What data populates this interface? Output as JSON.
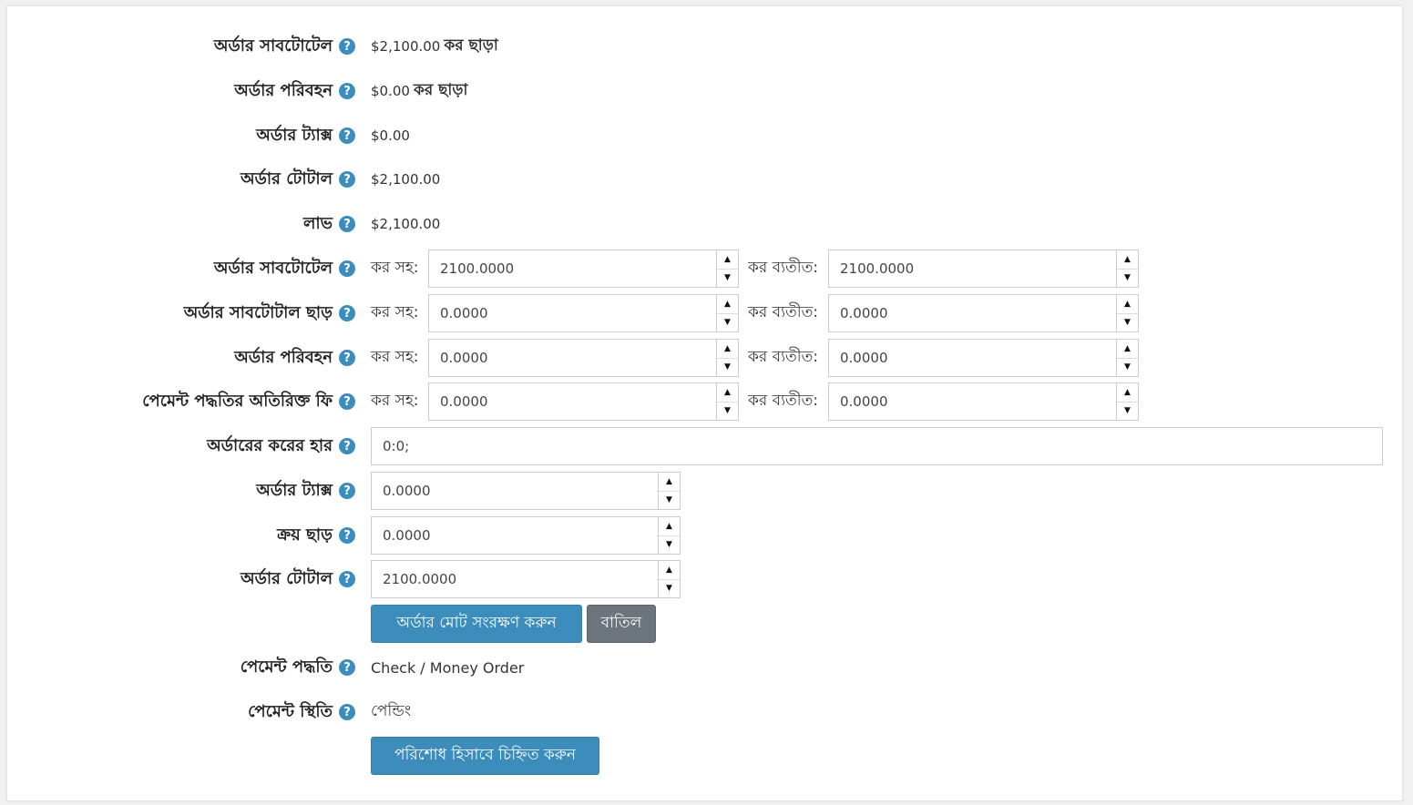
{
  "summary": {
    "subtotal": {
      "label": "অর্ডার সাবটোটেল",
      "value": "$2,100.00",
      "suffix": "কর ছাড়া"
    },
    "shipping": {
      "label": "অর্ডার পরিবহন",
      "value": "$0.00",
      "suffix": "কর ছাড়া"
    },
    "tax": {
      "label": "অর্ডার ট্যাক্স",
      "value": "$0.00"
    },
    "total": {
      "label": "অর্ডার টোটাল",
      "value": "$2,100.00"
    },
    "profit": {
      "label": "লাভ",
      "value": "$2,100.00"
    }
  },
  "edit": {
    "incl_label": "কর সহ:",
    "excl_label": "কর ব্যতীত:",
    "subtotal": {
      "label": "অর্ডার সাবটোটেল",
      "incl": "2100.0000",
      "excl": "2100.0000"
    },
    "subtotal_discount": {
      "label": "অর্ডার সাবটোটাল ছাড়",
      "incl": "0.0000",
      "excl": "0.0000"
    },
    "shipping": {
      "label": "অর্ডার পরিবহন",
      "incl": "0.0000",
      "excl": "0.0000"
    },
    "payment_fee": {
      "label": "পেমেন্ট পদ্ধতির অতিরিক্ত ফি",
      "incl": "0.0000",
      "excl": "0.0000"
    },
    "tax_rates": {
      "label": "অর্ডারের করের হার",
      "value": "0:0;"
    },
    "tax": {
      "label": "অর্ডার ট্যাক্স",
      "value": "0.0000"
    },
    "discount": {
      "label": "ক্রয় ছাড়",
      "value": "0.0000"
    },
    "total": {
      "label": "অর্ডার টোটাল",
      "value": "2100.0000"
    },
    "save_label": "অর্ডার মোট সংরক্ষণ করুন",
    "cancel_label": "বাতিল"
  },
  "payment": {
    "method": {
      "label": "পেমেন্ট পদ্ধতি",
      "value": "Check / Money Order"
    },
    "status": {
      "label": "পেমেন্ট স্থিতি",
      "value": "পেন্ডিং"
    },
    "mark_paid_label": "পরিশোধ হিসাবে চিহ্নিত করুন"
  },
  "icons": {
    "help": "question-circle-icon",
    "spin_up": "triangle-up-icon",
    "spin_down": "triangle-down-icon"
  },
  "colors": {
    "primary": "#3c8dbc",
    "secondary": "#6c757d"
  }
}
